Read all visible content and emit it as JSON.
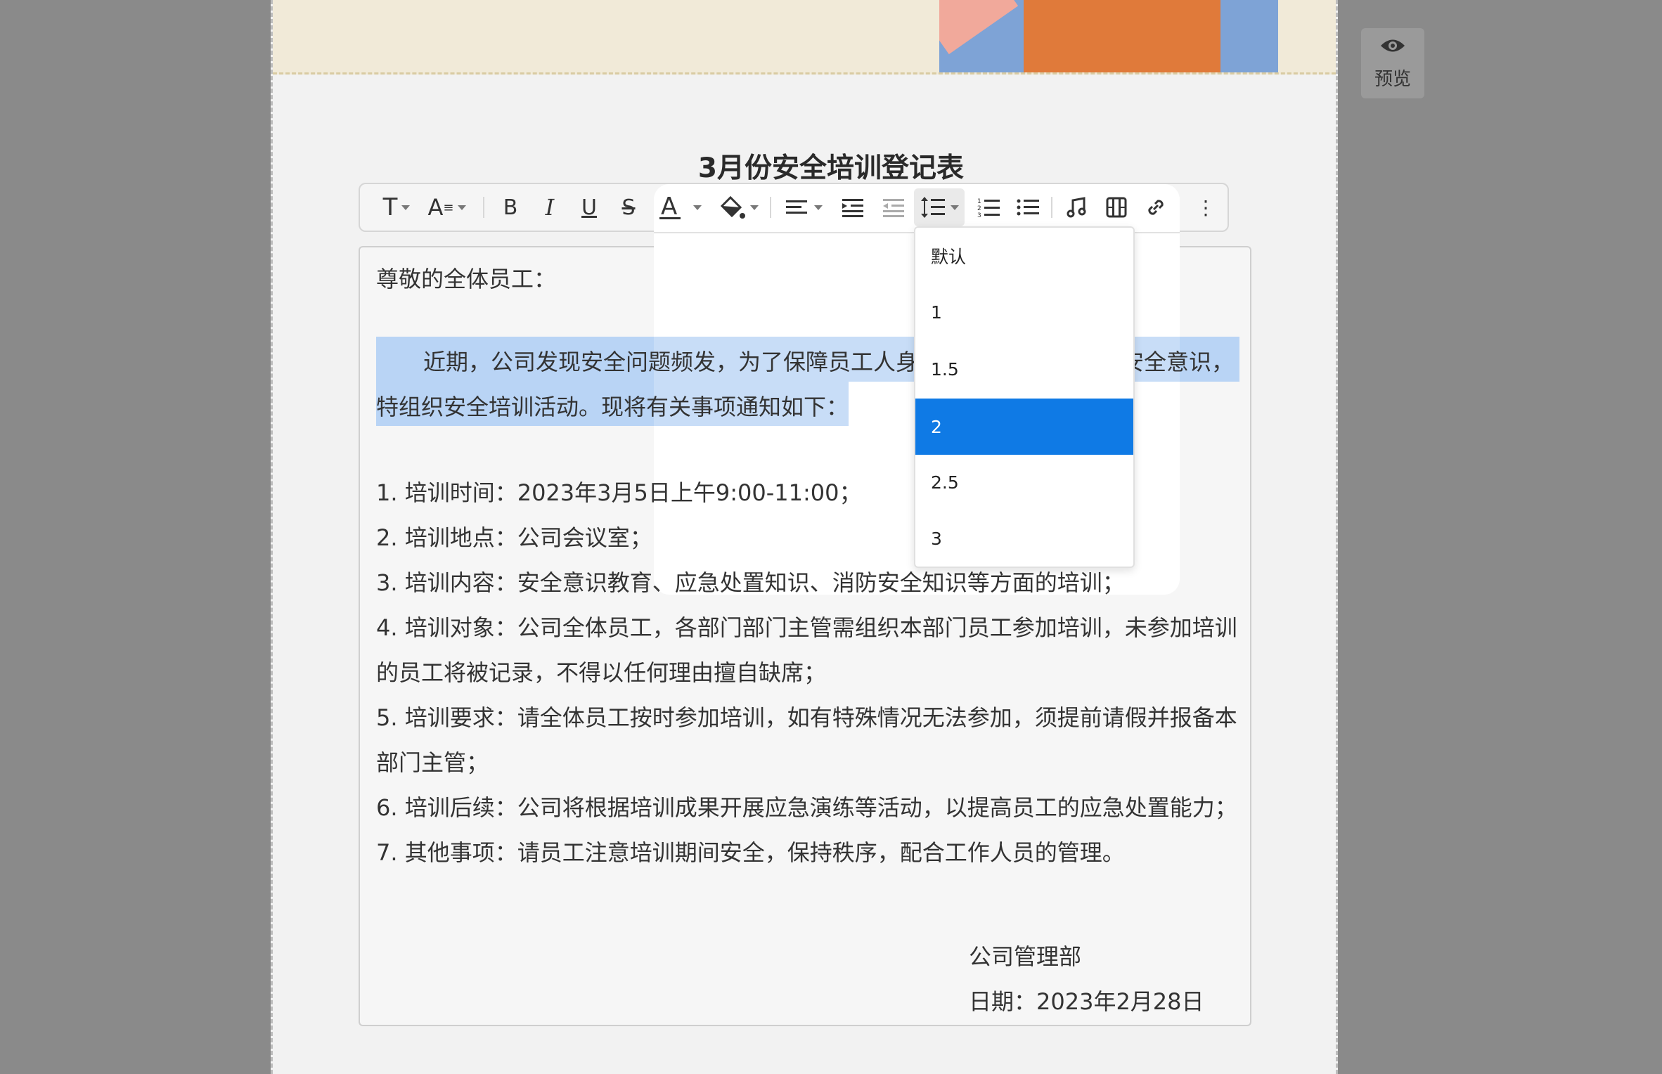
{
  "document": {
    "title": "3月份安全培训登记表",
    "greeting": "尊敬的全体员工：",
    "intro_line1_a": "近期，公司发现安全问题频发，为了保障员工人身",
    "intro_line1_b": "安全意识，",
    "intro_line2": "特组织安全培训活动。现将有关事项通知如下：",
    "items": [
      "1. 培训时间：2023年3月5日上午9:00-11:00；",
      "2. 培训地点：公司会议室；",
      "3. 培训内容：安全意识教育、应急处置知识、消防安全知识等方面的培训；",
      "4. 培训对象：公司全体员工，各部门部门主管需组织本部门员工参加培训，未参加培训",
      "的员工将被记录，不得以任何理由擅自缺席；",
      "5. 培训要求：请全体员工按时参加培训，如有特殊情况无法参加，须提前请假并报备本",
      "部门主管；",
      "6. 培训后续：公司将根据培训成果开展应急演练等活动，以提高员工的应急处置能力；",
      "7. 其他事项：请员工注意培训期间安全，保持秩序，配合工作人员的管理。"
    ],
    "signature": "公司管理部",
    "date": "日期：2023年2月28日"
  },
  "toolbar": {
    "bold": "B",
    "italic": "I",
    "underline": "U",
    "strike": "S",
    "text_style": "T",
    "font_size": "A",
    "more": "⋮"
  },
  "line_height_menu": {
    "options": [
      "默认",
      "1",
      "1.5",
      "2",
      "2.5",
      "3"
    ],
    "selected": "2"
  },
  "preview": {
    "label": "预览"
  },
  "colors": {
    "accent": "#0f7ae5",
    "selection": "#b9d4f5"
  }
}
